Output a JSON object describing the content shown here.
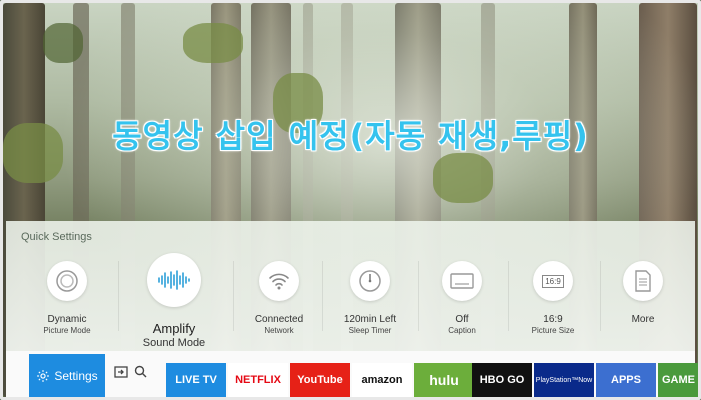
{
  "overlay": {
    "title": "동영상 삽입 예정(자동 재생,루핑)"
  },
  "quick_settings": {
    "title": "Quick Settings",
    "items": [
      {
        "icon": "dynamic-icon",
        "label": "Dynamic",
        "sublabel": "Picture Mode"
      },
      {
        "icon": "soundwave-icon",
        "label": "Amplify",
        "sublabel": "Sound Mode"
      },
      {
        "icon": "wifi-icon",
        "label": "Connected",
        "sublabel": "Network"
      },
      {
        "icon": "clock-icon",
        "label": "120min Left",
        "sublabel": "Sleep Timer"
      },
      {
        "icon": "caption-icon",
        "label": "Off",
        "sublabel": "Caption"
      },
      {
        "icon": "aspect-ratio-icon",
        "label": "16:9",
        "sublabel": "Picture Size",
        "icon_text": "16:9"
      },
      {
        "icon": "document-icon",
        "label": "More",
        "sublabel": ""
      }
    ]
  },
  "bottom_bar": {
    "settings_label": "Settings",
    "apps": [
      {
        "name": "live-tv",
        "label": "LIVE TV",
        "bg": "#1e8ce0",
        "fg": "#ffffff"
      },
      {
        "name": "netflix",
        "label": "NETFLIX",
        "bg": "#ffffff",
        "fg": "#e50914"
      },
      {
        "name": "youtube",
        "label": "YouTube",
        "bg": "#e62117",
        "fg": "#ffffff"
      },
      {
        "name": "amazon",
        "label": "amazon",
        "bg": "#ffffff",
        "fg": "#111111"
      },
      {
        "name": "hulu",
        "label": "hulu",
        "bg": "#6cae3b",
        "fg": "#ffffff"
      },
      {
        "name": "hbo-go",
        "label": "HBO GO",
        "bg": "#111111",
        "fg": "#ffffff"
      },
      {
        "name": "playstation-now",
        "label": "PlayStation™Now",
        "bg": "#0a2a8a",
        "fg": "#ffffff"
      },
      {
        "name": "apps",
        "label": "APPS",
        "bg": "#3c6fd0",
        "fg": "#ffffff"
      },
      {
        "name": "game",
        "label": "GAME",
        "bg": "#4a9a3c",
        "fg": "#ffffff"
      }
    ]
  }
}
